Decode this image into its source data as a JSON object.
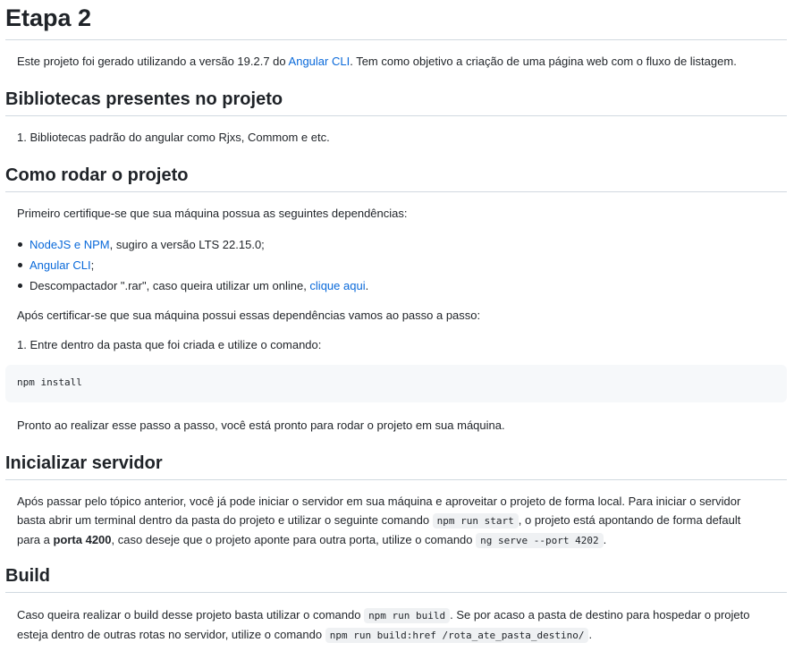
{
  "title": "Etapa 2",
  "intro": {
    "before": "Este projeto foi gerado utilizando a versão 19.2.7 do ",
    "link": "Angular CLI",
    "after": ". Tem como objetivo a criação de uma página web com o fluxo de listagem."
  },
  "section_libs": {
    "heading": "Bibliotecas presentes no projeto",
    "item": "1. Bibliotecas padrão do angular como Rjxs, Commom e etc."
  },
  "section_run": {
    "heading": "Como rodar o projeto",
    "intro": "Primeiro certifique-se que sua máquina possua as seguintes dependências:",
    "deps": [
      {
        "link": "NodeJS e NPM",
        "text": ", sugiro a versão LTS 22.15.0;"
      },
      {
        "link": "Angular CLI",
        "text": ";"
      },
      {
        "before": "Descompactador \".rar\", caso queira utilizar um online, ",
        "link": "clique aqui",
        "text": "."
      }
    ],
    "after_deps": "Após certificar-se que sua máquina possui essas dependências vamos ao passo a passo:",
    "step1": "1. Entre dentro da pasta que foi criada e utilize o comando:",
    "command": "npm install",
    "done": "Pronto ao realizar esse passo a passo, você está pronto para rodar o projeto em sua máquina."
  },
  "section_server": {
    "heading": "Inicializar servidor",
    "p1": "Após passar pelo tópico anterior, você já pode iniciar o servidor em sua máquina e aproveitar o projeto de forma local. Para iniciar o servidor",
    "p2a": "basta abrir um terminal dentro da pasta do projeto e utilizar o seguinte comando ",
    "code1": "npm run start",
    "p2b": ", o projeto está apontando de forma default",
    "p3a": "para a ",
    "port": "porta 4200",
    "p3b": ", caso deseje que o projeto aponte para outra porta, utilize o comando ",
    "code2": "ng serve --port 4202",
    "p3c": "."
  },
  "section_build": {
    "heading": "Build",
    "p1a": "Caso queira realizar o build desse projeto basta utilizar o comando ",
    "code1": "npm run build",
    "p1b": ". Se por acaso a pasta de destino para hospedar o projeto",
    "p2a": "esteja dentro de outras rotas no servidor, utilize o comando ",
    "code2": "npm run build:href /rota_ate_pasta_destino/",
    "p2b": "."
  }
}
